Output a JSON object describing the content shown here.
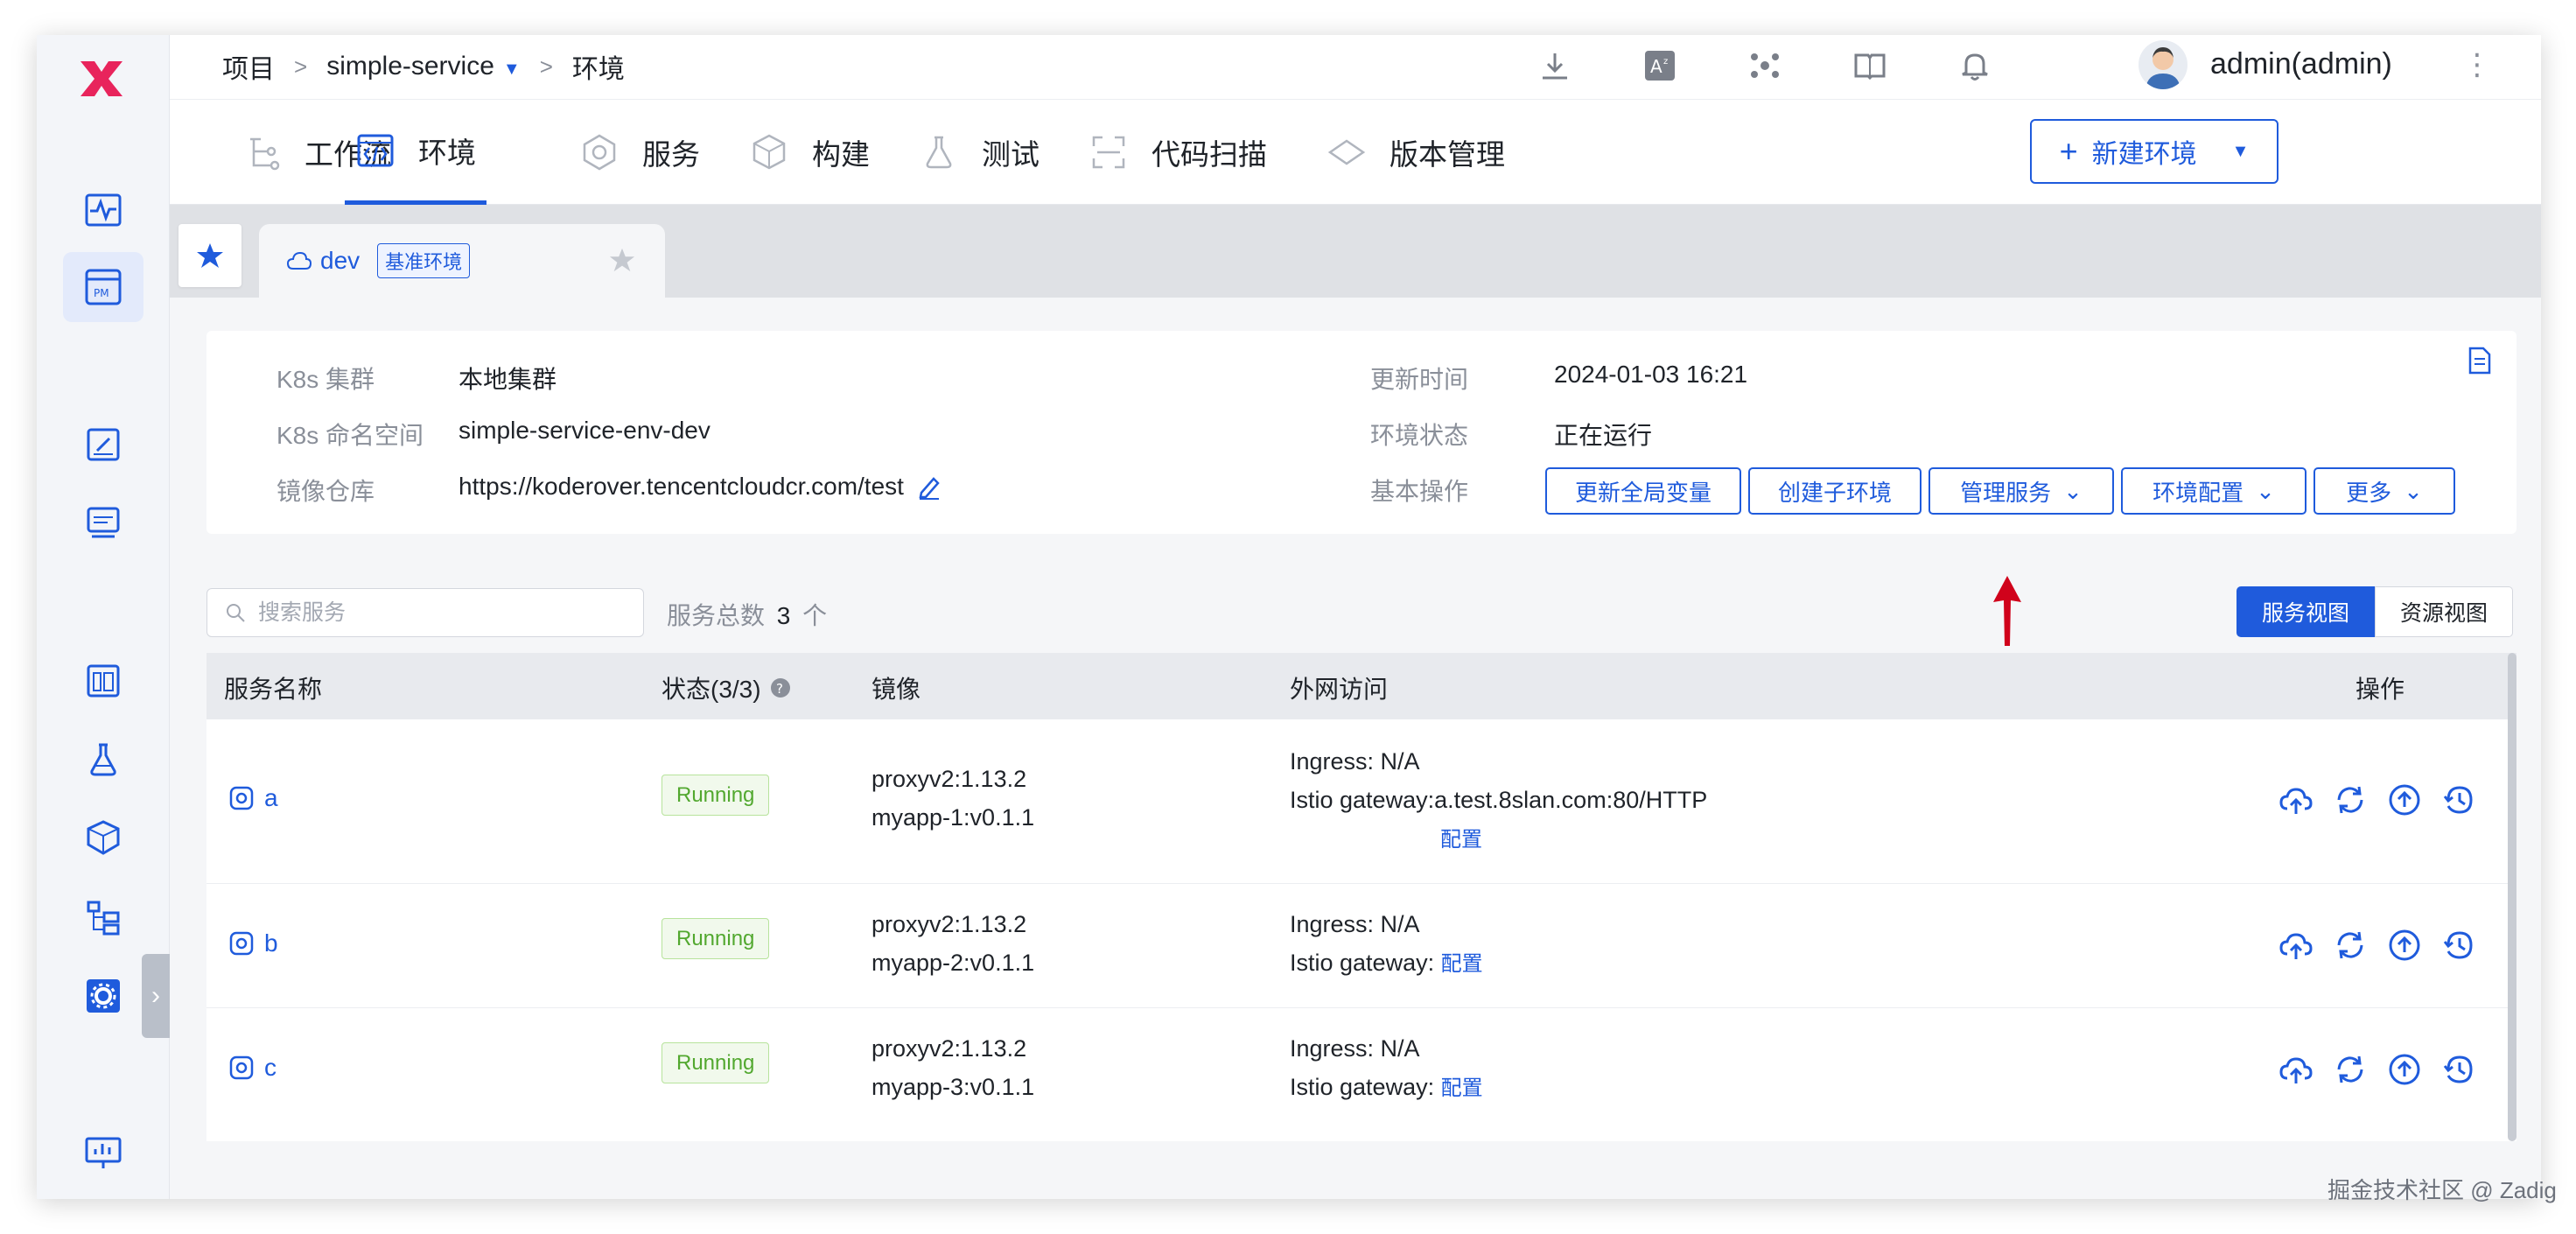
{
  "breadcrumb": {
    "root": "项目",
    "project": "simple-service",
    "page": "环境"
  },
  "user": {
    "name": "admin(admin)"
  },
  "nav": {
    "tabs": [
      {
        "label": "工作流",
        "icon": "workflow-icon"
      },
      {
        "label": "环境",
        "icon": "code-env-icon",
        "active": true
      },
      {
        "label": "服务",
        "icon": "service-icon"
      },
      {
        "label": "构建",
        "icon": "build-icon"
      },
      {
        "label": "测试",
        "icon": "flask-icon"
      },
      {
        "label": "代码扫描",
        "icon": "scan-icon"
      },
      {
        "label": "版本管理",
        "icon": "version-icon"
      }
    ],
    "new_env_button": "新建环境"
  },
  "env_tab": {
    "name": "dev",
    "badge": "基准环境"
  },
  "info": {
    "k8s_cluster_label": "K8s 集群",
    "k8s_cluster_value": "本地集群",
    "k8s_ns_label": "K8s 命名空间",
    "k8s_ns_value": "simple-service-env-dev",
    "registry_label": "镜像仓库",
    "registry_value": "https://koderover.tencentcloudcr.com/test",
    "updated_label": "更新时间",
    "updated_value": "2024-01-03 16:21",
    "status_label": "环境状态",
    "status_value": "正在运行",
    "ops_label": "基本操作"
  },
  "ops": {
    "update_vars": "更新全局变量",
    "create_sub_env": "创建子环境",
    "manage_services": "管理服务",
    "env_config": "环境配置",
    "more": "更多"
  },
  "search": {
    "placeholder": "搜索服务"
  },
  "service_count": {
    "label": "服务总数",
    "count": "3",
    "unit": "个"
  },
  "views": {
    "service_view": "服务视图",
    "resource_view": "资源视图"
  },
  "table": {
    "headers": {
      "name": "服务名称",
      "status": "状态(3/3)",
      "image": "镜像",
      "access": "外网访问",
      "actions": "操作"
    },
    "rows": [
      {
        "name": "a",
        "status": "Running",
        "images": [
          "proxyv2:1.13.2",
          "myapp-1:v0.1.1"
        ],
        "ingress": "Ingress: N/A",
        "istio_label": "Istio gateway:",
        "istio_value": "a.test.8slan.com:80/HTTP",
        "config": "配置"
      },
      {
        "name": "b",
        "status": "Running",
        "images": [
          "proxyv2:1.13.2",
          "myapp-2:v0.1.1"
        ],
        "ingress": "Ingress: N/A",
        "istio_label": "Istio gateway:",
        "config": "配置"
      },
      {
        "name": "c",
        "status": "Running",
        "images": [
          "proxyv2:1.13.2",
          "myapp-3:v0.1.1"
        ],
        "ingress": "Ingress: N/A",
        "istio_label": "Istio gateway:",
        "config": "配置"
      }
    ]
  },
  "watermark": "掘金技术社区 @ Zadig",
  "colors": {
    "primary": "#1f5bdc",
    "logo": "#e8245c",
    "running": "#52a82f",
    "arrow": "#d0021b"
  }
}
